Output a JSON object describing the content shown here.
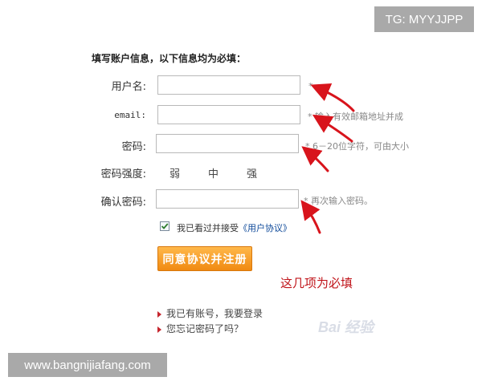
{
  "watermarks": {
    "top": "TG: MYYJJPP",
    "bottom": "www.bangnijiafang.com",
    "baidu": "Bai 经验"
  },
  "form": {
    "title": "填写账户信息，以下信息均为必填：",
    "fields": {
      "username": {
        "label": "用户名:",
        "value": "",
        "hint": "*"
      },
      "email": {
        "label": "email:",
        "value": "",
        "hint": "* 输入有效邮箱地址并成"
      },
      "password": {
        "label": "密码:",
        "value": "",
        "hint": "* 6－20位字符，可由大小"
      },
      "confirm": {
        "label": "确认密码:",
        "value": "",
        "hint": "* 再次输入密码。"
      }
    },
    "strength": {
      "label": "密码强度:",
      "levels": [
        "弱",
        "中",
        "强"
      ]
    },
    "agreement": {
      "checked": true,
      "text": "我已看过并接受",
      "link": "《用户协议》"
    },
    "submit_label": "同意协议并注册",
    "annotation": "这几项为必填"
  },
  "links": {
    "have_account": "我已有账号，我要登录",
    "forgot_password": "您忘记密码了吗？"
  },
  "colors": {
    "arrow": "#d8141c",
    "button": "#f39a1f",
    "annotation": "#c0141a",
    "link": "#0f4a9a"
  }
}
